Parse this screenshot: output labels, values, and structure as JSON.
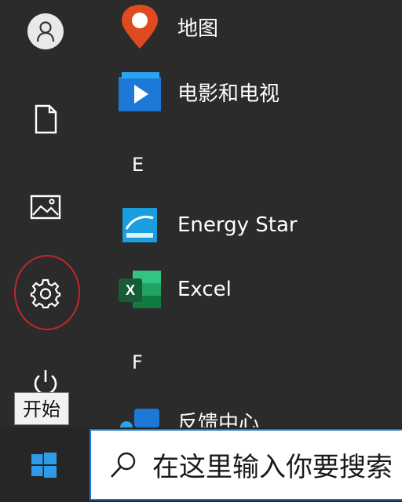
{
  "start_menu": {
    "apps": [
      {
        "label": "地图",
        "icon": "maps-icon"
      },
      {
        "label": "电影和电视",
        "icon": "movies-tv-icon"
      },
      {
        "label": "Energy Star",
        "icon": "energy-star-icon"
      },
      {
        "label": "Excel",
        "icon": "excel-icon"
      },
      {
        "label": "反馈中心",
        "icon": "feedback-hub-icon"
      }
    ],
    "sections": {
      "e": "E",
      "f": "F"
    },
    "excel_icon_letter": "X"
  },
  "rail": {
    "items": [
      "user-avatar-icon",
      "documents-icon",
      "pictures-icon",
      "settings-icon",
      "power-icon"
    ]
  },
  "tooltip": {
    "text": "开始"
  },
  "taskbar": {
    "search_placeholder": "在这里输入你要搜索",
    "accent": "#1b7ad1"
  },
  "colors": {
    "menu_bg": "#2b2b2b",
    "highlight_ring": "#c3262c",
    "windows_logo": "#2f9ae8"
  }
}
